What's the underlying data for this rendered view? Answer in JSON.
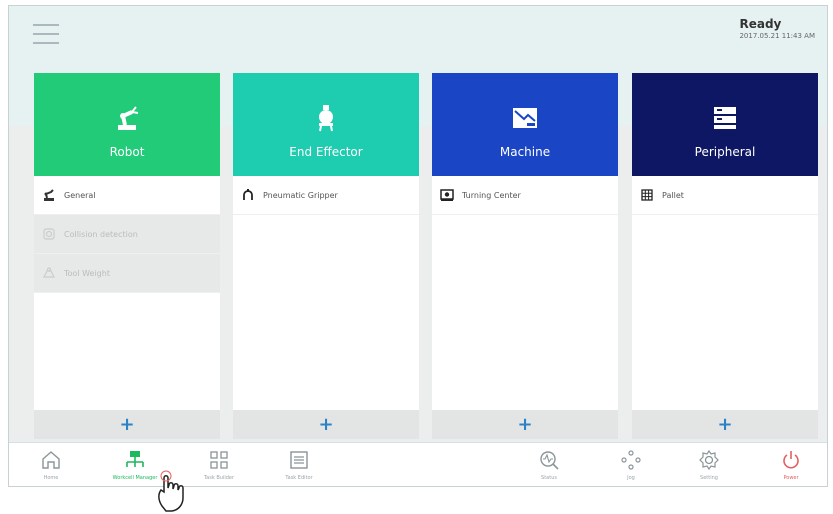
{
  "status": {
    "state": "Ready",
    "datetime": "2017.05.21 11:43 AM"
  },
  "cards": [
    {
      "title": "Robot",
      "color": "#21cb78",
      "icon": "robot-arm-icon",
      "items": [
        {
          "label": "General",
          "icon": "robot-general-icon",
          "disabled": false
        },
        {
          "label": "Collision detection",
          "icon": "collision-icon",
          "disabled": true
        },
        {
          "label": "Tool Weight",
          "icon": "tool-weight-icon",
          "disabled": true
        }
      ],
      "add": "+"
    },
    {
      "title": "End Effector",
      "color": "#1ecdb0",
      "icon": "gripper-icon",
      "items": [
        {
          "label": "Pneumatic Gripper",
          "icon": "pneumatic-gripper-icon",
          "disabled": false
        }
      ],
      "add": "+"
    },
    {
      "title": "Machine",
      "color": "#1a45c4",
      "icon": "machine-icon",
      "items": [
        {
          "label": "Turning Center",
          "icon": "turning-center-icon",
          "disabled": false
        }
      ],
      "add": "+"
    },
    {
      "title": "Peripheral",
      "color": "#0d1763",
      "icon": "peripheral-icon",
      "items": [
        {
          "label": "Pallet",
          "icon": "pallet-icon",
          "disabled": false
        }
      ],
      "add": "+"
    }
  ],
  "nav": {
    "home": "Home",
    "workcell": "Workcell Manager",
    "task_builder": "Task Builder",
    "task_editor": "Task Editor",
    "status": "Status",
    "jog": "Jog",
    "setting": "Setting",
    "power": "Power"
  },
  "colors": {
    "active": "#1fb85d",
    "power": "#e26060",
    "accent": "#2d82c6"
  }
}
